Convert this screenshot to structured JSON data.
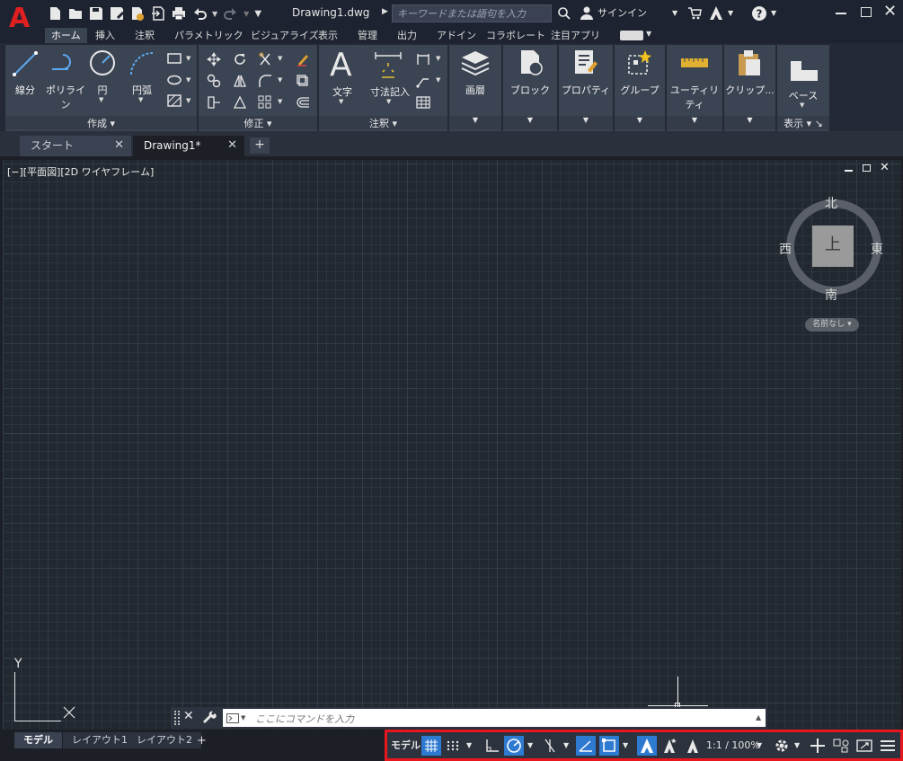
{
  "app": {
    "logo": "A"
  },
  "quick_access": [
    "new-icon",
    "open-icon",
    "save-icon",
    "save-as-icon",
    "export-icon",
    "import-icon",
    "plot-icon",
    "undo-icon",
    "redo-icon",
    "customize-icon"
  ],
  "title_bar": {
    "document": "Drawing1.dwg",
    "search_placeholder": "キーワードまたは語句を入力",
    "signin": "サインイン"
  },
  "ribbon_tabs": [
    "ホーム",
    "挿入",
    "注釈",
    "パラメトリック",
    "ビジュアライズ",
    "表示",
    "管理",
    "出力",
    "アドイン",
    "コラボレート",
    "注目アプリ"
  ],
  "ribbon": {
    "draw": {
      "title": "作成",
      "line": "線分",
      "polyline": "ポリライン",
      "circle": "円",
      "arc": "円弧"
    },
    "modify": {
      "title": "修正"
    },
    "annotation": {
      "title": "注釈",
      "text": "文字",
      "dimension": "寸法記入"
    },
    "layers": "画層",
    "block": "ブロック",
    "properties": "プロパティ",
    "groups": "グループ",
    "utilities": "ユーティリティ",
    "clipboard": "クリップ...",
    "view": {
      "title": "表示",
      "base": "ベース"
    }
  },
  "doc_tabs": [
    {
      "label": "スタート"
    },
    {
      "label": "Drawing1*"
    }
  ],
  "viewport": {
    "label": "[−][平面図][2D ワイヤフレーム]",
    "viewcube": {
      "face": "上",
      "north": "北",
      "south": "南",
      "east": "東",
      "west": "西",
      "named": "名前なし"
    },
    "ucs": {
      "y": "Y"
    }
  },
  "command_line": {
    "placeholder": "ここにコマンドを入力"
  },
  "layout_tabs": [
    "モデル",
    "レイアウト1",
    "レイアウト2"
  ],
  "status_bar": {
    "model": "モデル",
    "scale": "1:1 / 100%"
  },
  "colors": {
    "accent": "#2e7ad1",
    "highlight_border": "#e8171d",
    "logo": "#e02020"
  }
}
